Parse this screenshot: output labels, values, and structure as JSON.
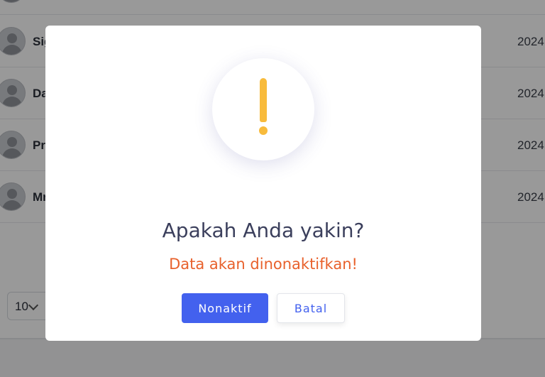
{
  "list": {
    "rows": [
      {
        "name": "",
        "date": ""
      },
      {
        "name": "Sig",
        "date": "2024"
      },
      {
        "name": "Da",
        "date": "2024"
      },
      {
        "name": "Pr",
        "date": "2024"
      },
      {
        "name": "Mr",
        "date": "2024"
      }
    ]
  },
  "pagination": {
    "page_size": "10"
  },
  "dialog": {
    "icon": "warning-exclamation-icon",
    "title": "Apakah Anda yakin?",
    "text": "Data akan dinonaktifkan!",
    "confirm_label": "Nonaktif",
    "cancel_label": "Batal"
  },
  "colors": {
    "overlay": "rgba(0,0,0,0.4)",
    "warning": "#f8bb3c",
    "title": "#3b3f5c",
    "text": "#e8612c",
    "confirm_bg": "#4361ee",
    "cancel_text": "#4361ee"
  }
}
